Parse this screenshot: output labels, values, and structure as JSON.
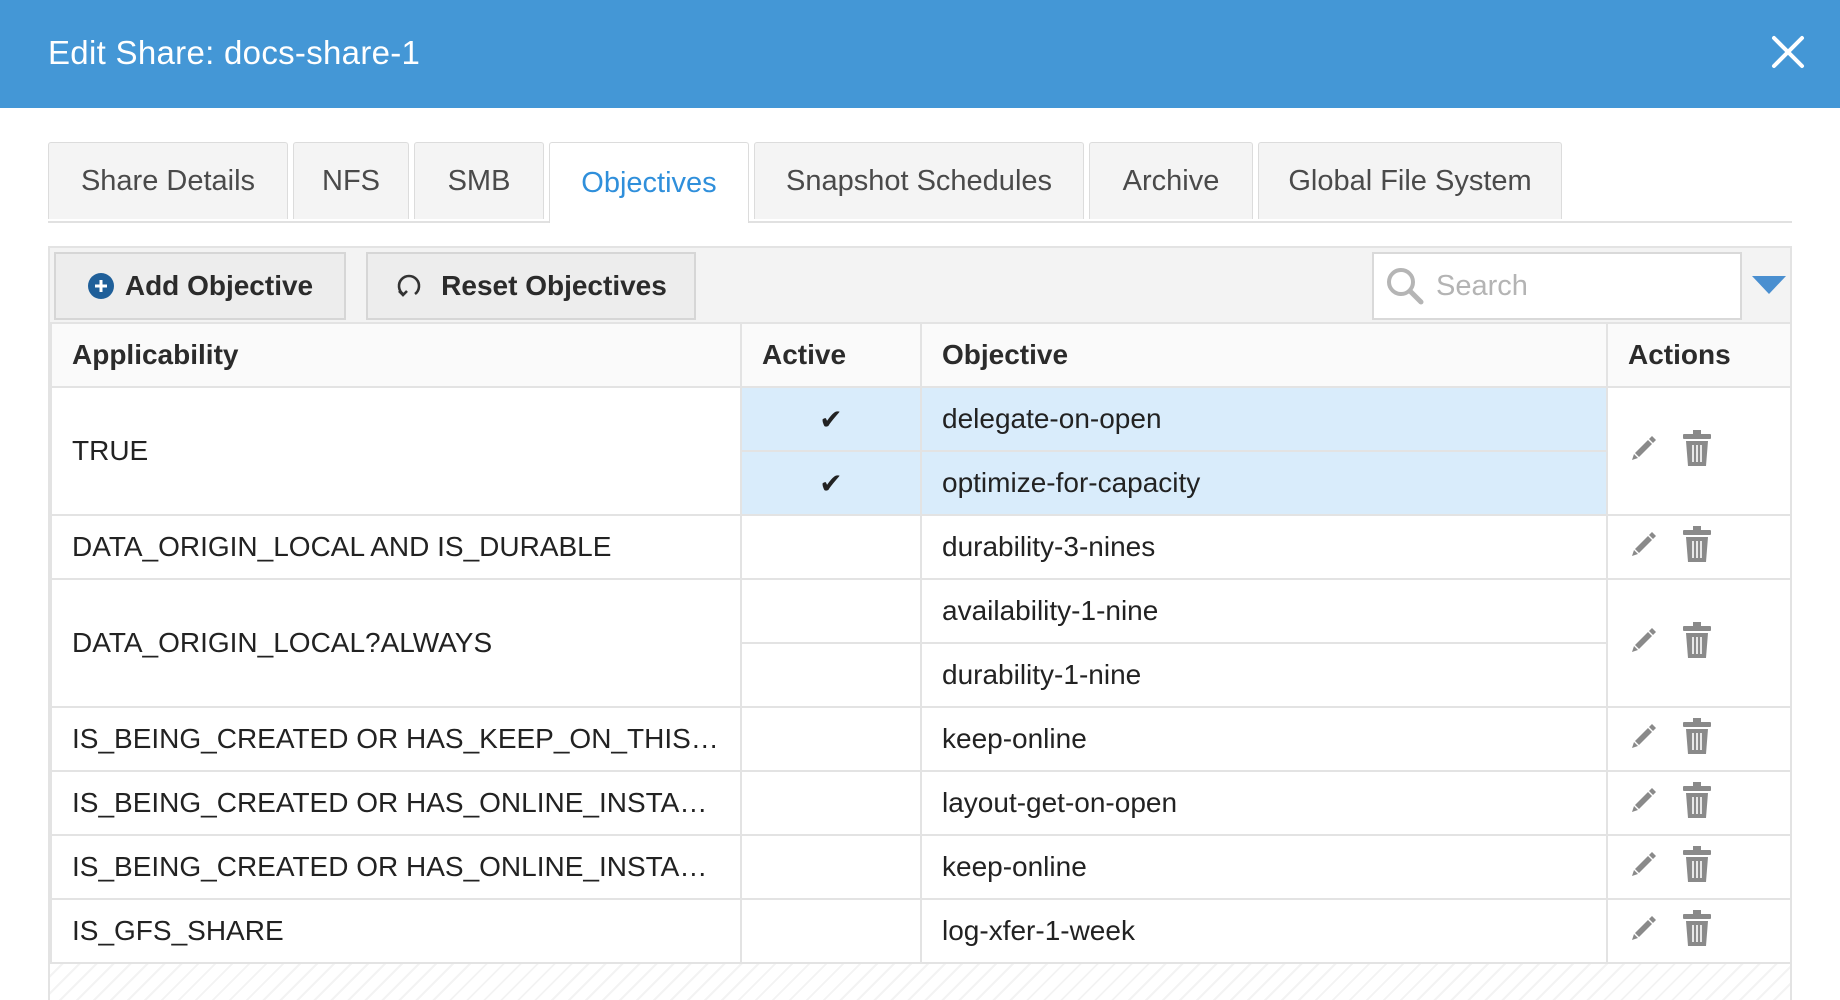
{
  "dialog": {
    "title": "Edit Share: docs-share-1"
  },
  "tabs": [
    {
      "label": "Share Details",
      "active": false
    },
    {
      "label": "NFS",
      "active": false
    },
    {
      "label": "SMB",
      "active": false
    },
    {
      "label": "Objectives",
      "active": true
    },
    {
      "label": "Snapshot Schedules",
      "active": false
    },
    {
      "label": "Archive",
      "active": false
    },
    {
      "label": "Global File System",
      "active": false
    }
  ],
  "toolbar": {
    "add_label": "Add Objective",
    "reset_label": "Reset Objectives",
    "search_placeholder": "Search"
  },
  "table": {
    "columns": [
      "Applicability",
      "Active",
      "Objective",
      "Actions"
    ],
    "groups": [
      {
        "applicability": "TRUE",
        "rows": [
          {
            "active": "✔",
            "objective": "delegate-on-open",
            "highlight": true
          },
          {
            "active": "✔",
            "objective": "optimize-for-capacity",
            "highlight": true
          }
        ]
      },
      {
        "applicability": "DATA_ORIGIN_LOCAL AND IS_DURABLE",
        "rows": [
          {
            "active": "",
            "objective": "durability-3-nines",
            "highlight": false
          }
        ]
      },
      {
        "applicability": "DATA_ORIGIN_LOCAL?ALWAYS",
        "rows": [
          {
            "active": "",
            "objective": "availability-1-nine",
            "highlight": false
          },
          {
            "active": "",
            "objective": "durability-1-nine",
            "highlight": false
          }
        ]
      },
      {
        "applicability": "IS_BEING_CREATED OR HAS_KEEP_ON_THIS_SITE",
        "rows": [
          {
            "active": "",
            "objective": "keep-online",
            "highlight": false
          }
        ]
      },
      {
        "applicability": "IS_BEING_CREATED OR HAS_ONLINE_INSTANCE",
        "rows": [
          {
            "active": "",
            "objective": "layout-get-on-open",
            "highlight": false
          }
        ]
      },
      {
        "applicability": "IS_BEING_CREATED OR HAS_ONLINE_INSTANCE ...",
        "rows": [
          {
            "active": "",
            "objective": "keep-online",
            "highlight": false
          }
        ]
      },
      {
        "applicability": "IS_GFS_SHARE",
        "rows": [
          {
            "active": "",
            "objective": "log-xfer-1-week",
            "highlight": false
          }
        ]
      }
    ]
  },
  "icons": {
    "close": "close-icon",
    "add": "plus-circle-icon",
    "reset": "refresh-icon",
    "search": "search-icon",
    "filter": "chevron-down-icon",
    "edit": "pencil-icon",
    "delete": "trash-icon"
  },
  "colors": {
    "header_bar": "#4497d6",
    "active_tab_text": "#2f8fdb",
    "highlight_row": "#d9ecfb"
  }
}
